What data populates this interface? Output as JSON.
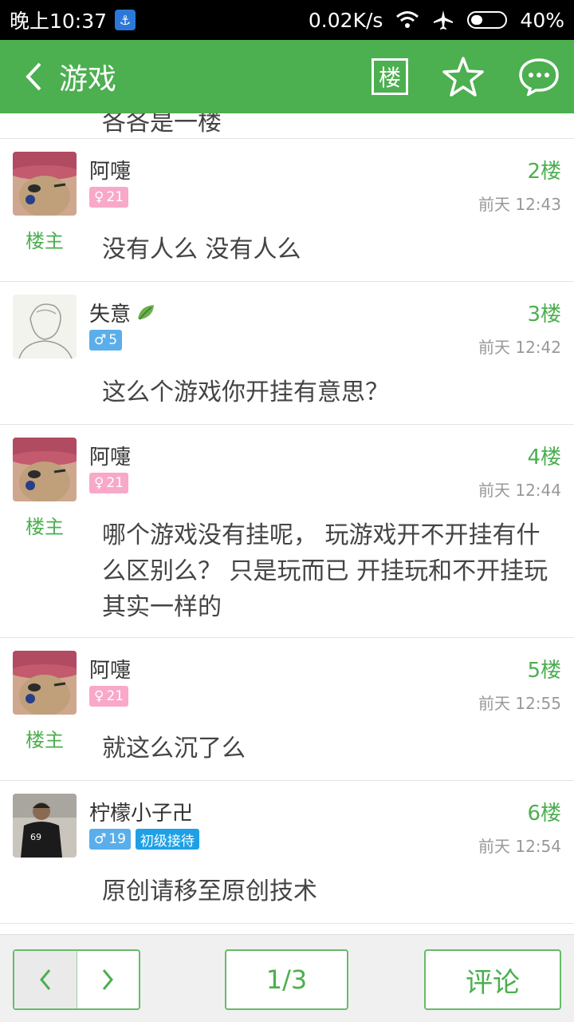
{
  "status_bar": {
    "time": "晚上10:37",
    "net_speed": "0.02K/s",
    "battery": "40%"
  },
  "header": {
    "title": "游戏",
    "floor_icon_label": "楼"
  },
  "partial_post": {
    "content": "各各是一楼"
  },
  "posts": [
    {
      "name": "阿嚏",
      "badge_gender": "female",
      "badge_level": "21",
      "owner": "楼主",
      "floor": "2楼",
      "time": "前天 12:43",
      "content": "没有人么  没有人么"
    },
    {
      "name": "失意",
      "badge_gender": "male",
      "badge_level": "5",
      "floor": "3楼",
      "time": "前天 12:42",
      "content": "这么个游戏你开挂有意思？"
    },
    {
      "name": "阿嚏",
      "badge_gender": "female",
      "badge_level": "21",
      "owner": "楼主",
      "floor": "4楼",
      "time": "前天 12:44",
      "content": "哪个游戏没有挂呢， 玩游戏开不开挂有什么区别么？ 只是玩而已  开挂玩和不开挂玩其实一样的"
    },
    {
      "name": "阿嚏",
      "badge_gender": "female",
      "badge_level": "21",
      "owner": "楼主",
      "floor": "5楼",
      "time": "前天 12:55",
      "content": "就这么沉了么"
    },
    {
      "name": "柠檬小子卍",
      "badge_gender": "male",
      "badge_level": "19",
      "rank": "初级接待",
      "floor": "6楼",
      "time": "前天 12:54",
      "content": "原创请移至原创技术"
    }
  ],
  "bottom_bar": {
    "page": "1/3",
    "comment_label": "评论"
  },
  "colors": {
    "accent": "#4caf50",
    "female_badge": "#f8a8c8",
    "male_badge": "#5aaeea",
    "rank_badge": "#1fa0e6"
  }
}
